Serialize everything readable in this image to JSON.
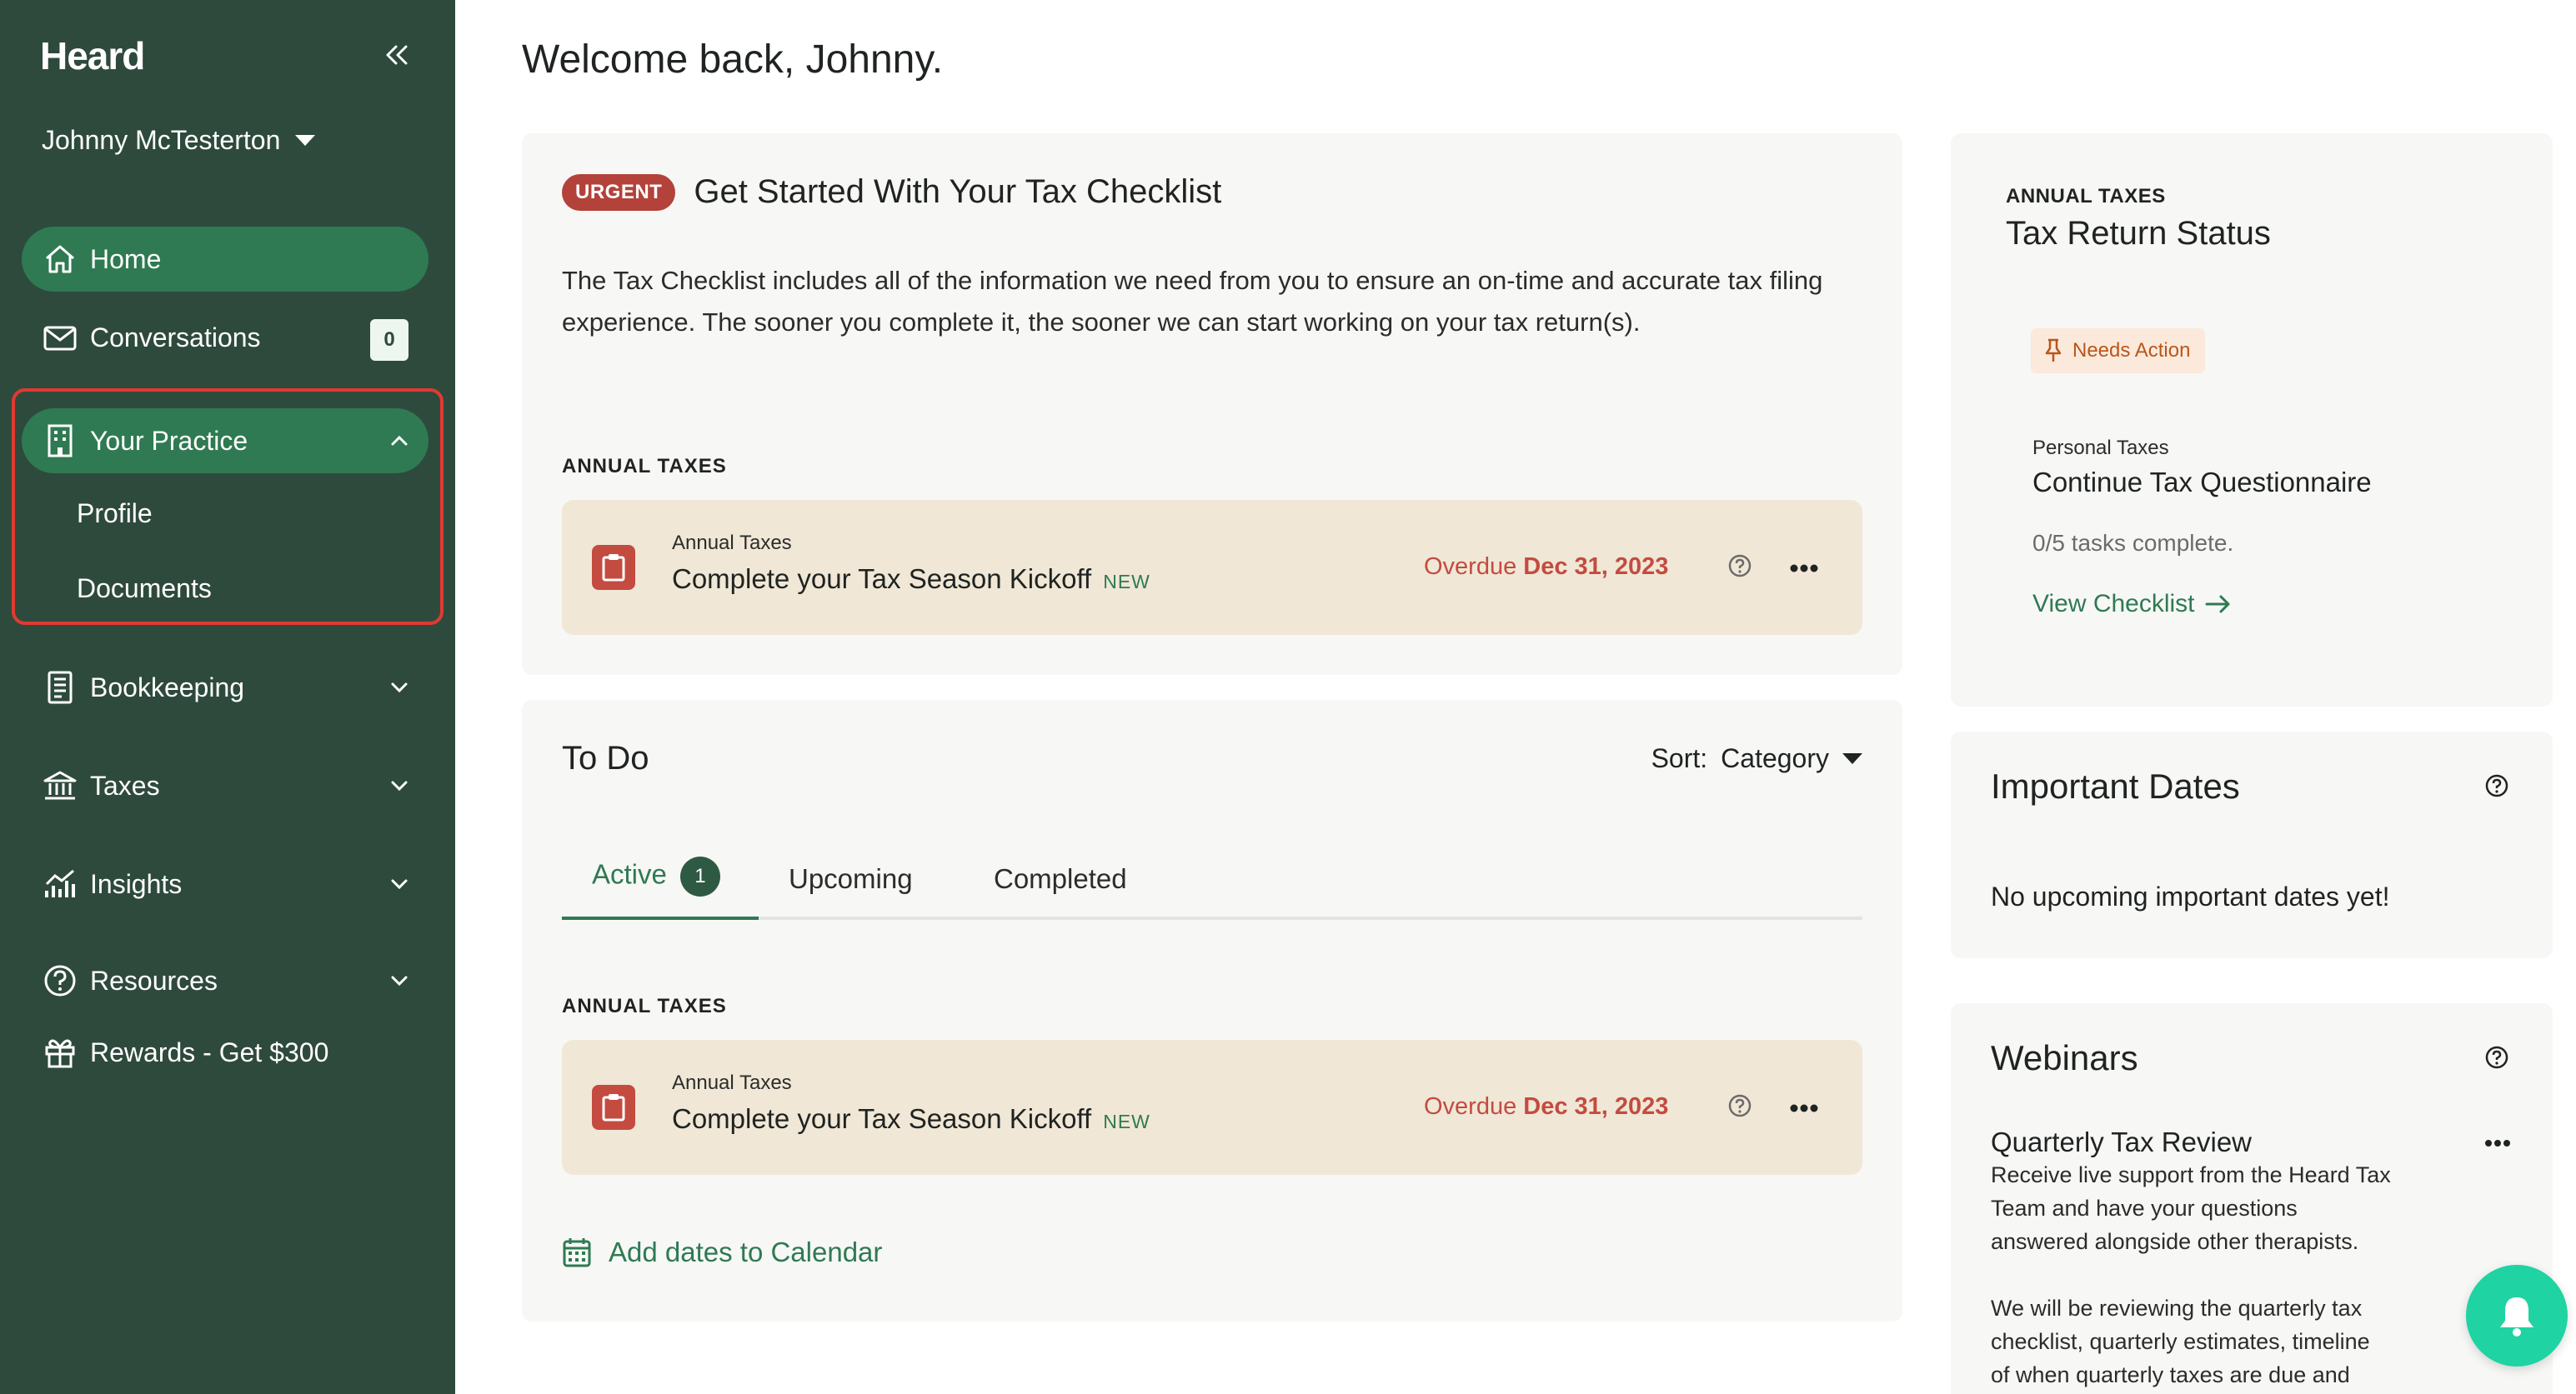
{
  "sidebar": {
    "brand": "Heard",
    "user": "Johnny McTesterton",
    "conversations_count": "0",
    "items": {
      "home": "Home",
      "conversations": "Conversations",
      "practice": "Your Practice",
      "profile": "Profile",
      "documents": "Documents",
      "bookkeeping": "Bookkeeping",
      "taxes": "Taxes",
      "insights": "Insights",
      "resources": "Resources",
      "rewards": "Rewards - Get $300"
    }
  },
  "main": {
    "welcome": "Welcome back, Johnny.",
    "checklist": {
      "badge": "URGENT",
      "title": "Get Started With Your Tax Checklist",
      "description": "The Tax Checklist includes all of the information we need from you to ensure an on-time and accurate tax filing experience. The sooner you complete it, the sooner we can start working on your tax return(s).",
      "section": "ANNUAL TAXES",
      "task": {
        "category": "Annual Taxes",
        "title": "Complete your Tax Season Kickoff",
        "new_tag": "NEW",
        "due_prefix": "Overdue",
        "due_date": "Dec 31, 2023"
      }
    },
    "todo": {
      "title": "To Do",
      "sort_label": "Sort:",
      "sort_value": "Category",
      "tabs": {
        "active": "Active",
        "active_count": "1",
        "upcoming": "Upcoming",
        "completed": "Completed"
      },
      "section": "ANNUAL TAXES",
      "task": {
        "category": "Annual Taxes",
        "title": "Complete your Tax Season Kickoff",
        "new_tag": "NEW",
        "due_prefix": "Overdue",
        "due_date": "Dec 31, 2023"
      },
      "calendar_link": "Add dates to Calendar"
    }
  },
  "right": {
    "tax_status": {
      "label": "ANNUAL TAXES",
      "title": "Tax Return Status",
      "status": "Needs Action",
      "sub_label": "Personal Taxes",
      "sub_title": "Continue Tax Questionnaire",
      "progress_text": "0/5 tasks complete.",
      "link": "View Checklist"
    },
    "important_dates": {
      "title": "Important Dates",
      "empty": "No upcoming important dates yet!"
    },
    "webinars": {
      "title": "Webinars",
      "item_title": "Quarterly Tax Review",
      "line1": "Receive live support from the Heard Tax",
      "line2": "Team and have your questions",
      "line3": "answered alongside other therapists.",
      "line4": "We will be reviewing the quarterly tax",
      "line5": "checklist, quarterly estimates, timeline",
      "line6": "of when quarterly taxes are due and"
    }
  },
  "colors": {
    "sidebar_bg": "#2e4a3d",
    "active_nav": "#2f7a52",
    "urgent": "#b3423a",
    "task_bg": "#f0e7d6",
    "accent_green": "#2f7a52",
    "bell": "#1fd3a3"
  }
}
